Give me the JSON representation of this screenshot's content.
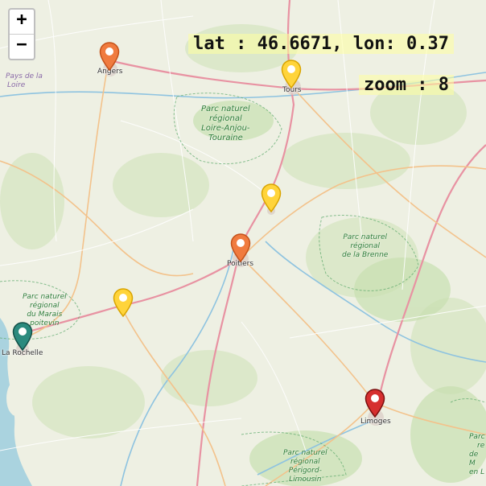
{
  "readout": {
    "latlon": "lat : 46.6671, lon: 0.37",
    "zoom": "zoom : 8"
  },
  "zoom_control": {
    "in_label": "+",
    "out_label": "−"
  },
  "places": {
    "angers": "Angers",
    "tours": "Tours",
    "poitiers": "Poitiers",
    "la_rochelle": "La Rochelle",
    "limoges": "Limoges"
  },
  "region": {
    "l1": "Pays de la",
    "l2": "Loire"
  },
  "parks": {
    "loire_anjou": [
      "Parc naturel",
      "régional",
      "Loire-Anjou-",
      "Touraine"
    ],
    "brenne": [
      "Parc naturel",
      "régional",
      "de la Brenne"
    ],
    "marais": [
      "Parc naturel",
      "régional",
      "du Marais",
      "poitevin"
    ],
    "perigord": [
      "Parc naturel",
      "régional",
      "Périgord-",
      "Limousin"
    ],
    "east": [
      "Parc",
      "re",
      "de M",
      "en L"
    ]
  },
  "colors": {
    "orange": "#f07b3f",
    "yellow": "#ffd43b",
    "teal": "#2b8a7e",
    "red": "#d62f2f",
    "water": "#aad3df"
  },
  "markers": [
    {
      "name": "angers-marker",
      "color": "orange"
    },
    {
      "name": "tours-marker",
      "color": "yellow"
    },
    {
      "name": "chatellerault-marker",
      "color": "yellow"
    },
    {
      "name": "poitiers-marker",
      "color": "orange"
    },
    {
      "name": "niort-marker",
      "color": "yellow"
    },
    {
      "name": "la-rochelle-marker",
      "color": "teal"
    },
    {
      "name": "limoges-marker",
      "color": "red"
    }
  ]
}
